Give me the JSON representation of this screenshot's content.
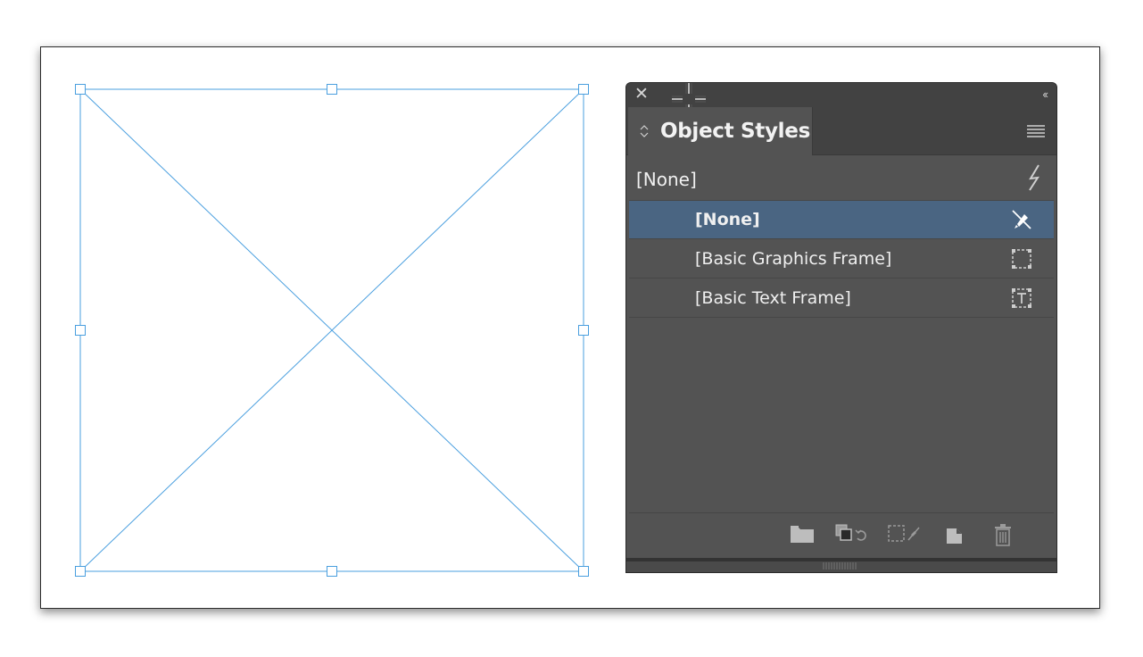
{
  "panel": {
    "title": "Object Styles",
    "default_style": "[None]",
    "styles": [
      {
        "label": "[None]",
        "selected": true,
        "icon": "pen-slash-icon"
      },
      {
        "label": "[Basic Graphics Frame]",
        "selected": false,
        "icon": "graphics-frame-icon"
      },
      {
        "label": "[Basic Text Frame]",
        "selected": false,
        "icon": "text-frame-icon"
      }
    ],
    "footer_icons": [
      "new-folder-icon",
      "clear-overrides-icon",
      "clear-attributes-icon",
      "new-style-icon",
      "trash-icon"
    ]
  },
  "colors": {
    "selection": "#4a9fdf",
    "panel_bg": "#535353",
    "selected_row": "#4a6582"
  }
}
